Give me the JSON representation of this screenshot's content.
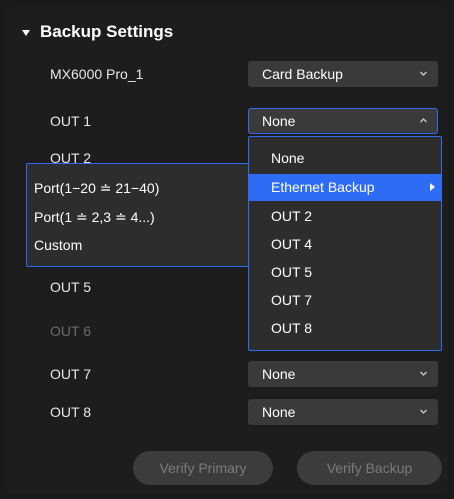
{
  "section": {
    "title": "Backup Settings"
  },
  "rows": [
    {
      "label": "MX6000 Pro_1",
      "value": "Card Backup"
    },
    {
      "label": "OUT 1",
      "value": "None"
    },
    {
      "label": "OUT 2",
      "value": ""
    },
    {
      "label": "OUT 5",
      "value": ""
    },
    {
      "label": "OUT 6",
      "value": ""
    },
    {
      "label": "OUT 7",
      "value": "None"
    },
    {
      "label": "OUT 8",
      "value": "None"
    }
  ],
  "dropdown": {
    "items": [
      "None",
      "Ethernet Backup",
      "OUT 2",
      "OUT 4",
      "OUT 5",
      "OUT 7",
      "OUT 8"
    ],
    "highlighted": "Ethernet Backup"
  },
  "submenu": {
    "items": [
      "Port(1−20 ≐ 21−40)",
      "Port(1 ≐ 2,3 ≐ 4...)",
      "Custom"
    ]
  },
  "buttons": {
    "verify_primary": "Verify Primary",
    "verify_backup": "Verify Backup"
  },
  "colors": {
    "accent": "#2f6cf5",
    "background": "#1d1d1d",
    "select_bg": "#3a3a3a",
    "disabled_text": "#6a6a6a"
  },
  "icons": {
    "section_toggle": "caret-down-icon",
    "select_chevron": "chevron-down-icon",
    "submenu_arrow": "caret-right-icon"
  }
}
